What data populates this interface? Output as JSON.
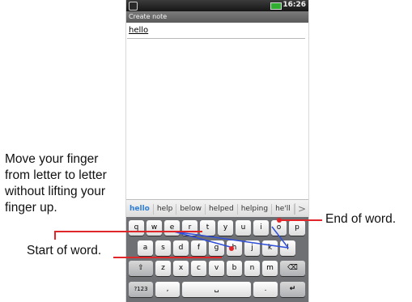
{
  "annotations": {
    "instruction": "Move your finger from letter to letter without lifting your finger up.",
    "start": "Start of word.",
    "end": "End of word."
  },
  "status_bar": {
    "time": "16:26",
    "battery_icon": "battery-icon",
    "app_icon": "notification-icon"
  },
  "title_bar": {
    "title": "Create note"
  },
  "editor": {
    "text": "hello"
  },
  "suggestions": [
    "hello",
    "help",
    "below",
    "helped",
    "helping",
    "he'll"
  ],
  "suggestion_more": ">",
  "keyboard": {
    "row1": [
      "q",
      "w",
      "e",
      "r",
      "t",
      "y",
      "u",
      "i",
      "o",
      "p"
    ],
    "row2": [
      "a",
      "s",
      "d",
      "f",
      "g",
      "h",
      "j",
      "k",
      "l"
    ],
    "row3": [
      "z",
      "x",
      "c",
      "v",
      "b",
      "n",
      "m"
    ],
    "shift": "⇧",
    "backspace": "⌫",
    "symbols": "?123",
    "comma": ",",
    "space": "␣",
    "period": ".",
    "enter": "↵"
  },
  "colors": {
    "callout": "#e1262a",
    "swipe_path": "#2f4fd8",
    "suggestion_highlight": "#2f7fd8"
  }
}
